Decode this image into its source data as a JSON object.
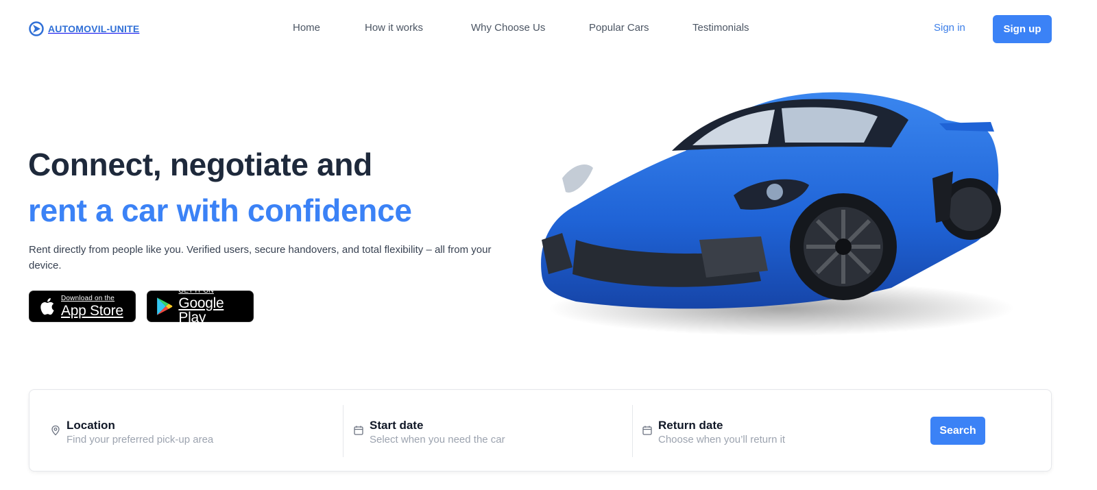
{
  "brand": {
    "name": "AUTOMOVIL-UNITE",
    "color": "#2f6fd6"
  },
  "nav": {
    "items": [
      {
        "label": "Home"
      },
      {
        "label": "How it works"
      },
      {
        "label": "Why Choose Us"
      },
      {
        "label": "Popular Cars"
      },
      {
        "label": "Testimonials"
      }
    ]
  },
  "auth": {
    "signin_label": "Sign in",
    "signup_label": "Sign up"
  },
  "hero": {
    "title_line1": "Connect, negotiate and",
    "title_line2": "rent a car with confidence",
    "subtitle": "Rent directly from people like you. Verified users, secure handovers, and total flexibility – all from your device.",
    "accent_color": "#3b82f6"
  },
  "stores": {
    "appstore": {
      "small": "Download on the",
      "big": "App Store",
      "icon": "apple-icon"
    },
    "googleplay": {
      "small": "GET IT ON",
      "big": "Google Play",
      "icon": "google-play-icon"
    }
  },
  "search": {
    "location": {
      "label": "Location",
      "placeholder": "Find your preferred pick-up area",
      "icon": "map-pin-icon"
    },
    "start_date": {
      "label": "Start date",
      "placeholder": "Select when you need the car",
      "icon": "calendar-icon"
    },
    "return_date": {
      "label": "Return date",
      "placeholder": "Choose when you’ll return it",
      "icon": "calendar-icon"
    },
    "button_label": "Search"
  }
}
